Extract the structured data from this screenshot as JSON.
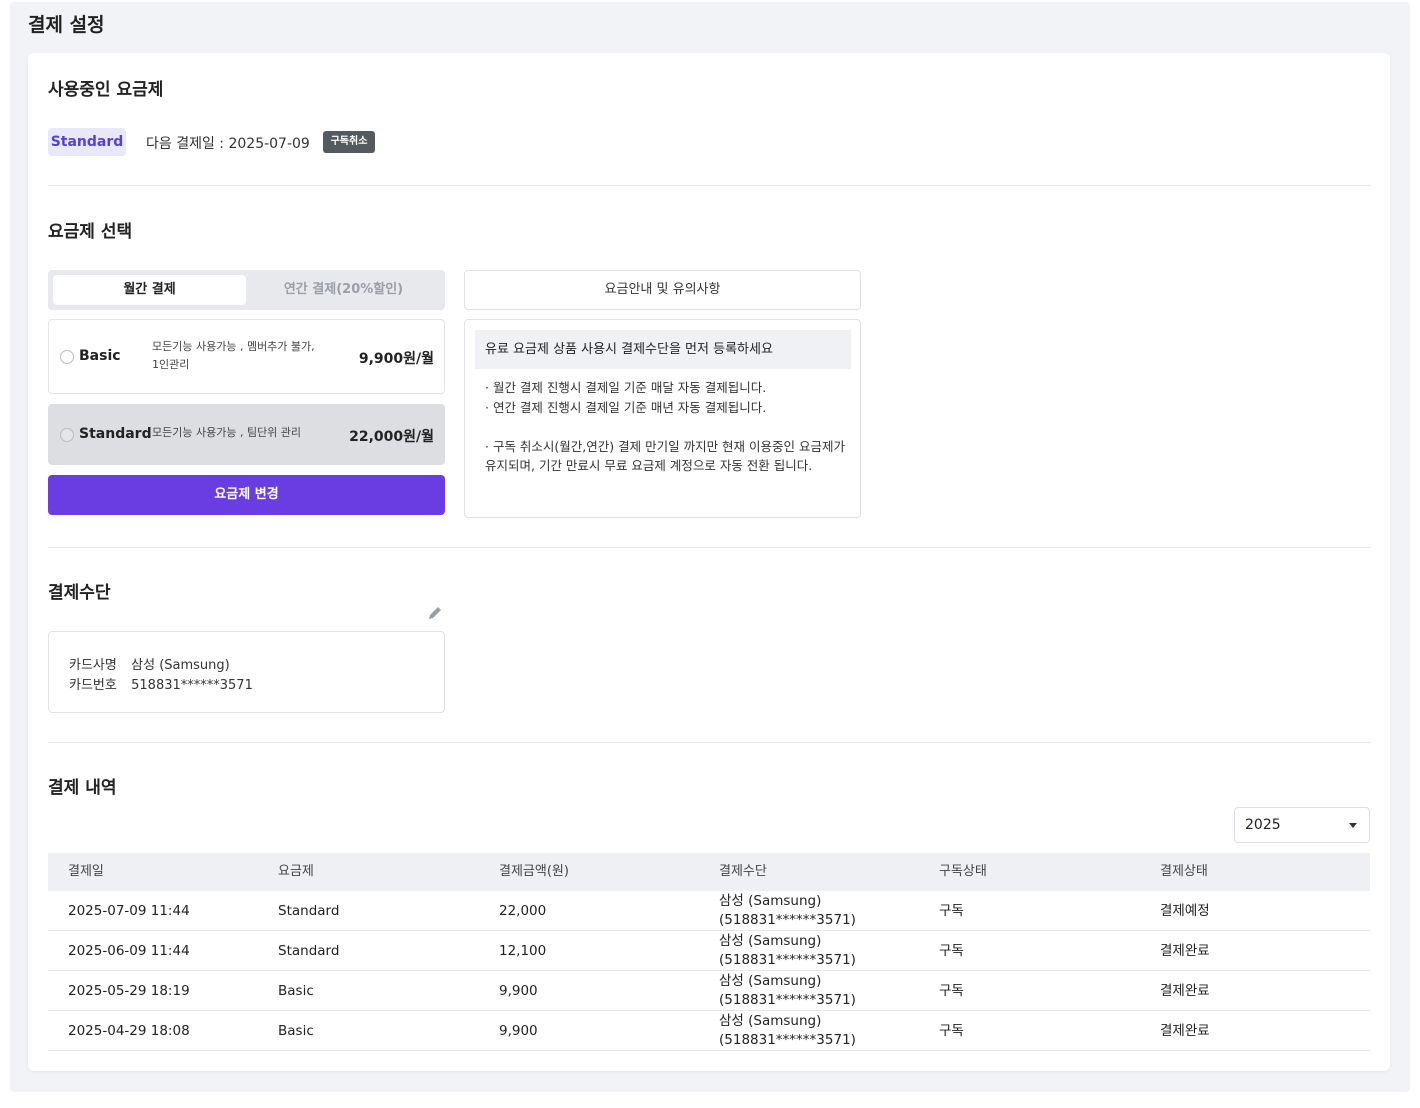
{
  "page": {
    "title": "결제 설정"
  },
  "current_plan": {
    "section_title": "사용중인 요금제",
    "plan_badge": "Standard",
    "next_payment": "다음 결제일 : 2025-07-09",
    "cancel_label": "구독취소"
  },
  "plan_select": {
    "section_title": "요금제 선택",
    "toggle": {
      "monthly": "월간 결제",
      "yearly": "연간 결제(20%할인)",
      "selected": "monthly"
    },
    "plans": [
      {
        "name": "Basic",
        "desc": "모든기능 사용가능 , 멤버추가 불가,\n1인관리",
        "price": "9,900원/월",
        "selected": false
      },
      {
        "name": "Standard",
        "desc": "모든기능 사용가능 , 팀단위 관리",
        "price": "22,000원/월",
        "selected": true
      }
    ],
    "change_button": "요금제 변경",
    "guide_tab": "요금안내 및 유의사항",
    "guide_head": "유료 요금제 상품 사용시 결제수단을 먼저 등록하세요",
    "guide_lines": [
      "· 월간 결제 진행시 결제일 기준 매달 자동 결제됩니다.",
      "· 연간 결제 진행시 결제일 기준 매년 자동 결제됩니다.",
      "· 구독 취소시(월간,연간) 결제 만기일 까지만 현재 이용중인 요금제가 유지되며, 기간 만료시 무료 요금제 계정으로 자동 전환 됩니다."
    ]
  },
  "payment_method": {
    "section_title": "결제수단",
    "card_company_label": "카드사명",
    "card_company": "삼성 (Samsung)",
    "card_number_label": "카드번호",
    "card_number": "518831******3571"
  },
  "history": {
    "section_title": "결제 내역",
    "year": "2025",
    "columns": [
      "결제일",
      "요금제",
      "결제금액(원)",
      "결제수단",
      "구독상태",
      "결제상태"
    ],
    "rows": [
      {
        "date": "2025-07-09 11:44",
        "plan": "Standard",
        "amount": "22,000",
        "method1": "삼성 (Samsung)",
        "method2": "(518831******3571)",
        "sub": "구독",
        "status": "결제예정"
      },
      {
        "date": "2025-06-09 11:44",
        "plan": "Standard",
        "amount": "12,100",
        "method1": "삼성 (Samsung)",
        "method2": "(518831******3571)",
        "sub": "구독",
        "status": "결제완료"
      },
      {
        "date": "2025-05-29 18:19",
        "plan": "Basic",
        "amount": "9,900",
        "method1": "삼성 (Samsung)",
        "method2": "(518831******3571)",
        "sub": "구독",
        "status": "결제완료"
      },
      {
        "date": "2025-04-29 18:08",
        "plan": "Basic",
        "amount": "9,900",
        "method1": "삼성 (Samsung)",
        "method2": "(518831******3571)",
        "sub": "구독",
        "status": "결제완료"
      }
    ]
  },
  "colors": {
    "accent": "#6a3de2",
    "badge_bg": "#e9e8fb",
    "badge_text": "#5a3ed8"
  }
}
